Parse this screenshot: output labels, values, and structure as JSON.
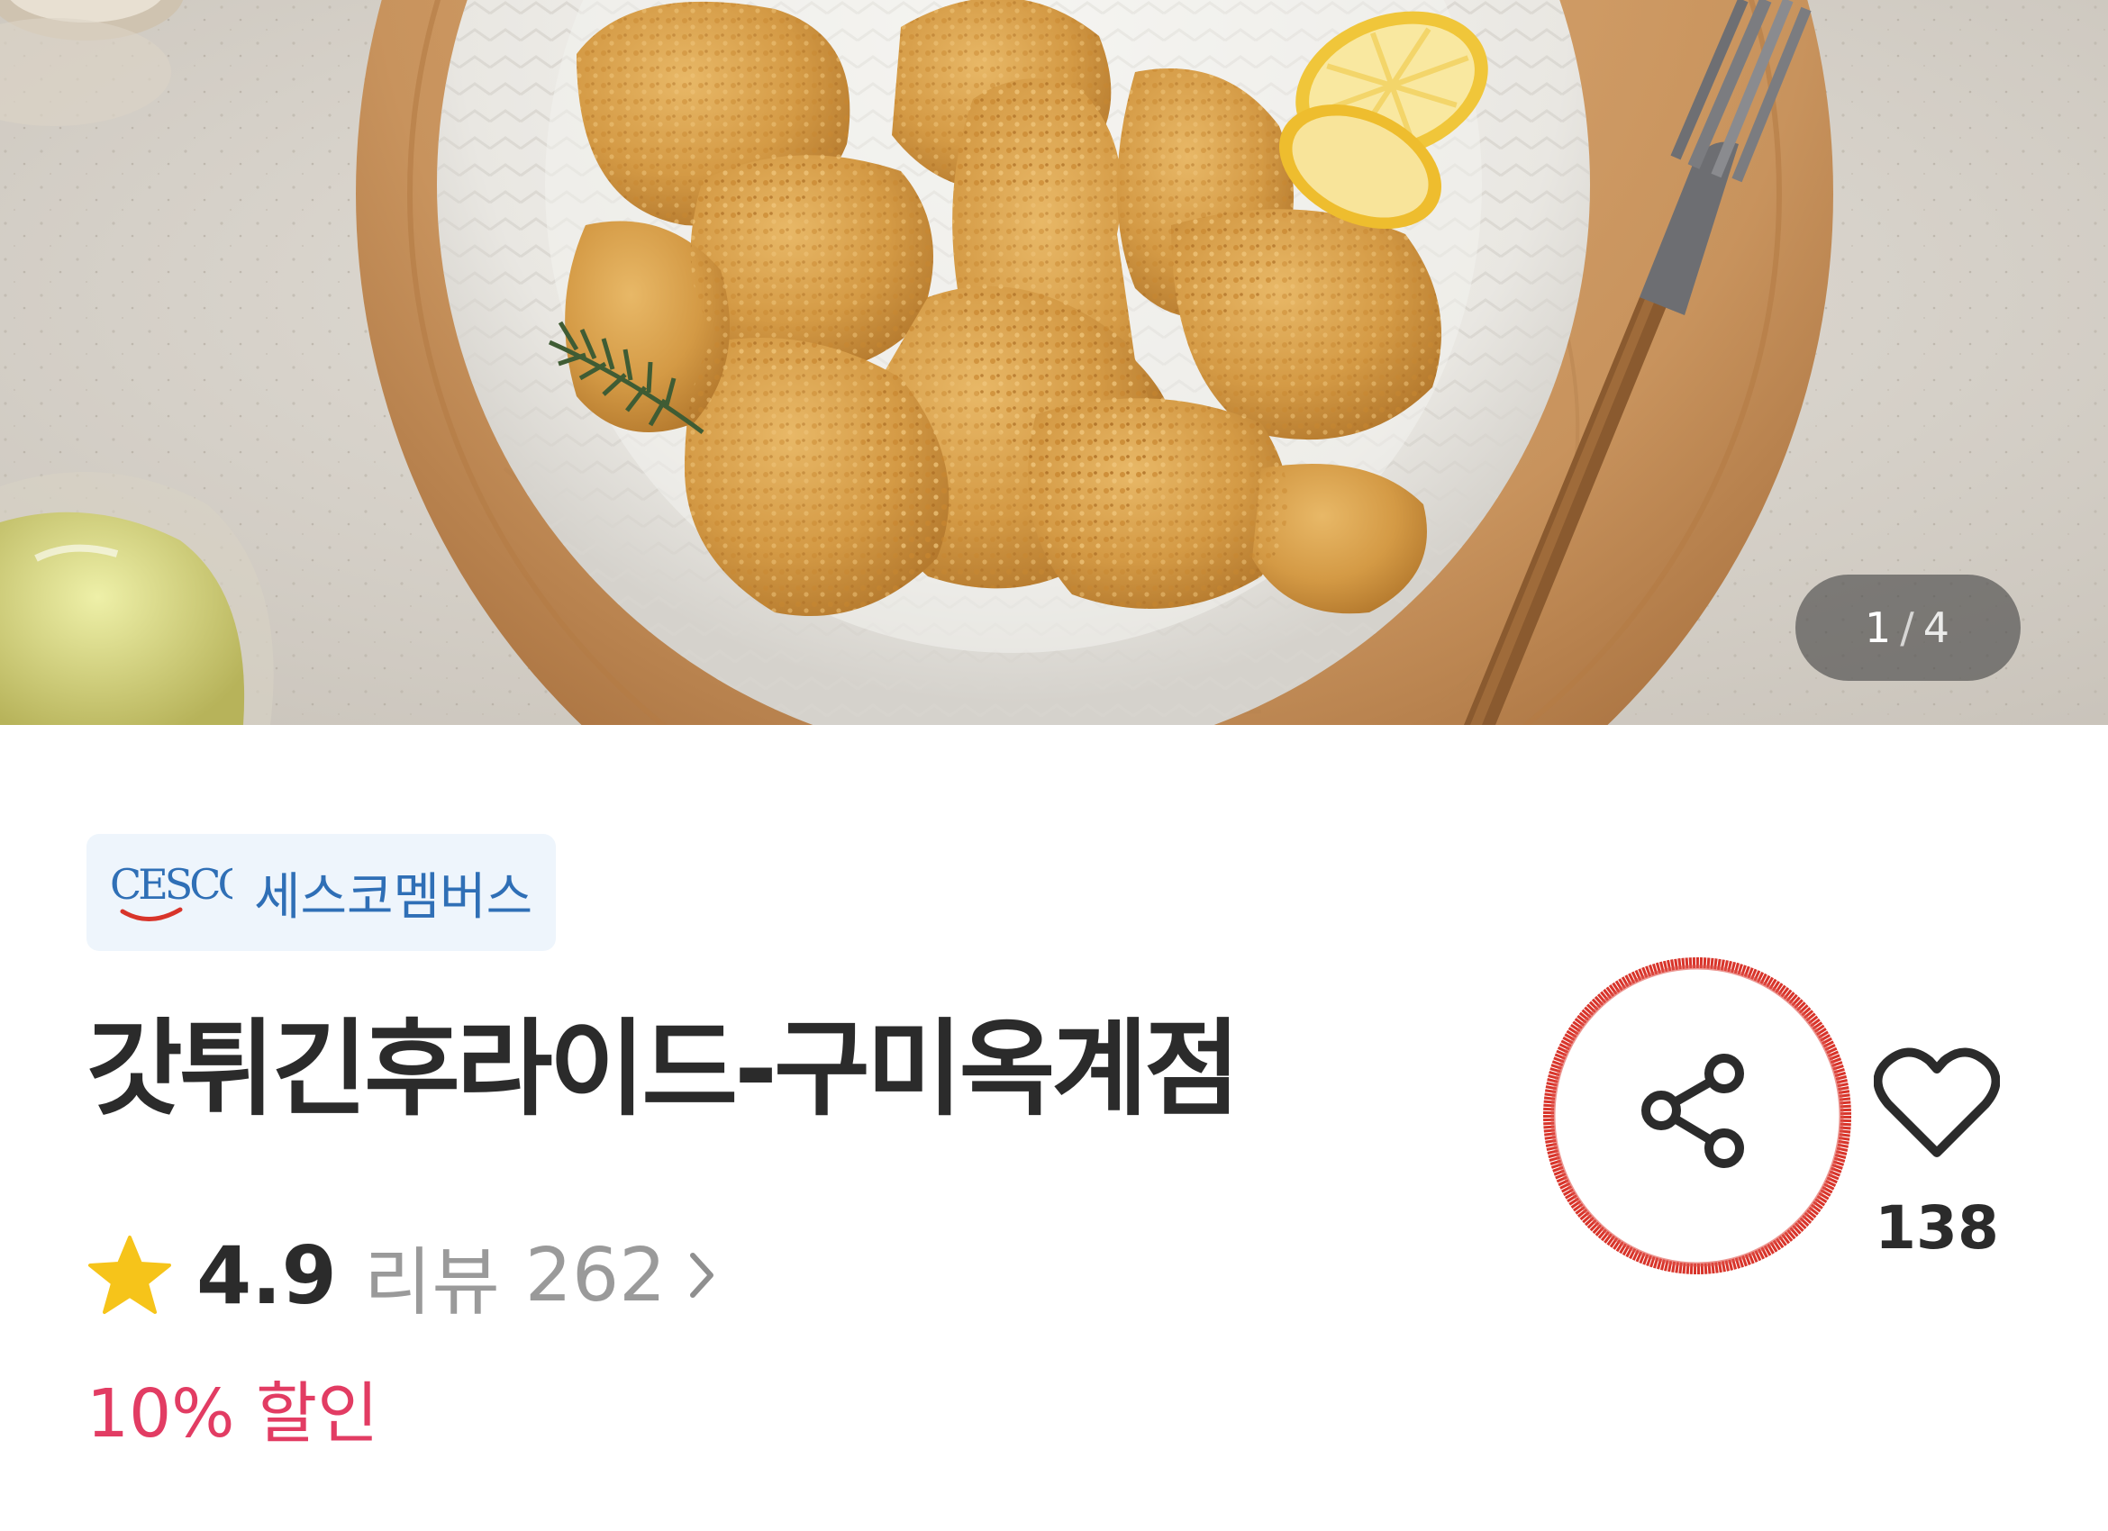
{
  "gallery": {
    "current": "1",
    "separator": "/",
    "total": "4",
    "photo_icon": "fried-chicken-photo"
  },
  "brand": {
    "logo_text": "CESCO",
    "name": "세스코멤버스",
    "color": "#2f6fb6",
    "background": "#eef5fc"
  },
  "product": {
    "title": "갓튀긴후라이드-구미옥계점"
  },
  "rating": {
    "star_icon": "star-icon",
    "value": "4.9",
    "review_label": "리뷰",
    "review_count": "262",
    "chevron_icon": "chevron-right-icon"
  },
  "promotion": {
    "discount_text": "10% 할인",
    "color": "#e23c63"
  },
  "actions": {
    "share_icon": "share-icon",
    "like_icon": "heart-outline-icon",
    "like_count": "138",
    "annotation_color": "#d8342a"
  }
}
